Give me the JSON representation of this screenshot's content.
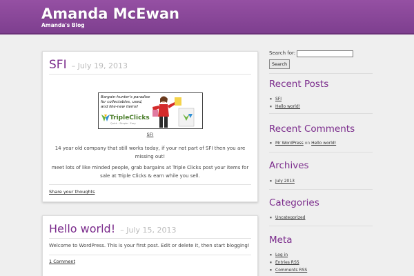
{
  "site": {
    "title": "Amanda McEwan",
    "description": "Amanda's Blog"
  },
  "posts": [
    {
      "title": "SFI",
      "date": "– July 19, 2013",
      "ad": {
        "line1": "Bargain-hunter's paradise",
        "line2": "for collectables, used,",
        "line3": "and like-new items!",
        "logo": "TripleClicks",
        "tagline": "Quick · Simple · Easy"
      },
      "ad_caption": "SFI",
      "paragraphs": [
        "14 year old company that still works today, if your not part of SFI then you are missing out!",
        "meet lots of like minded people, grab bargains at Triple Clicks post your items for sale at Triple Clicks & earn while you sell."
      ],
      "meta_link": "Share your thoughts"
    },
    {
      "title": "Hello world!",
      "date": "– July 15, 2013",
      "paragraphs": [
        "Welcome to WordPress. This is your first post. Edit or delete it, then start blogging!"
      ],
      "meta_link": "1 Comment"
    }
  ],
  "sidebar": {
    "search_label": "Search for:",
    "search_value": "",
    "search_button": "Search",
    "recent_posts": {
      "title": "Recent Posts",
      "items": [
        "SFI",
        "Hello world!"
      ]
    },
    "recent_comments": {
      "title": "Recent Comments",
      "author": "Mr WordPress",
      "on": "on",
      "post": "Hello world!"
    },
    "archives": {
      "title": "Archives",
      "items": [
        "July 2013"
      ]
    },
    "categories": {
      "title": "Categories",
      "items": [
        "Uncategorized"
      ]
    },
    "meta": {
      "title": "Meta",
      "items": [
        "Log in",
        "Entries RSS",
        "Comments RSS"
      ]
    }
  },
  "colors": {
    "header": "#8a4a9c",
    "accent": "#7b2c8c",
    "background": "#efefef"
  }
}
